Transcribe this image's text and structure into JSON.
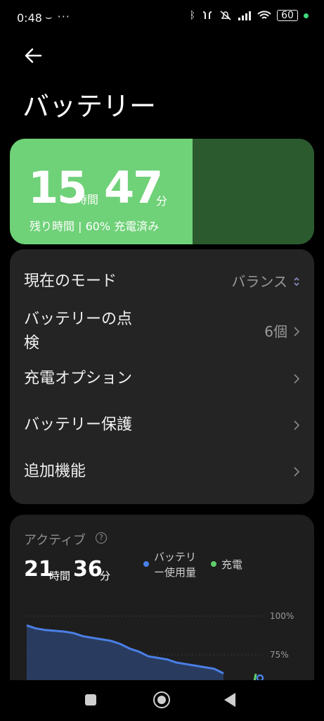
{
  "status_bar": {
    "time": "0:48",
    "extra": "⌣ ···",
    "battery_level": "60",
    "icons": [
      "bluetooth-icon",
      "earbuds-icon",
      "mute-icon",
      "signal-icon",
      "wifi-icon",
      "battery-icon"
    ],
    "dot_color": "#3ddc7a"
  },
  "header": {
    "title": "バッテリー"
  },
  "battery_card": {
    "hours": "15",
    "hours_unit": "時間",
    "minutes": "47",
    "minutes_unit": "分",
    "subtitle": "残り時間 | 60% 充電済み",
    "charge_fraction": 0.6,
    "fill_color": "#6fd178",
    "track_color": "#2b5a2f"
  },
  "settings": {
    "mode_label": "現在のモード",
    "mode_value": "バランス",
    "check_label_line1": "バッテリーの点",
    "check_label_line2": "検",
    "check_value": "6個",
    "charge_options": "充電オプション",
    "protection": "バッテリー保護",
    "extra_features": "追加機能"
  },
  "active": {
    "label": "アクティブ",
    "help": "?",
    "hours": "21",
    "hours_unit": "時間",
    "minutes": "36",
    "minutes_unit": "分",
    "legend_usage_line1": "バッテリ",
    "legend_usage_line2": "ー使用量",
    "legend_charge": "充電",
    "usage_color": "#4a7fe6",
    "charge_color": "#5fd06c"
  },
  "chart_data": {
    "type": "line",
    "y_ticks": [
      "100%",
      "75%"
    ],
    "ylim": [
      0,
      100
    ],
    "series": [
      {
        "name": "バッテリー使用量",
        "values": [
          94,
          92,
          91,
          90.5,
          90,
          89,
          87,
          86,
          85,
          84,
          82,
          79,
          77,
          74,
          73,
          72,
          70,
          69,
          68,
          67,
          66,
          63
        ]
      }
    ]
  }
}
